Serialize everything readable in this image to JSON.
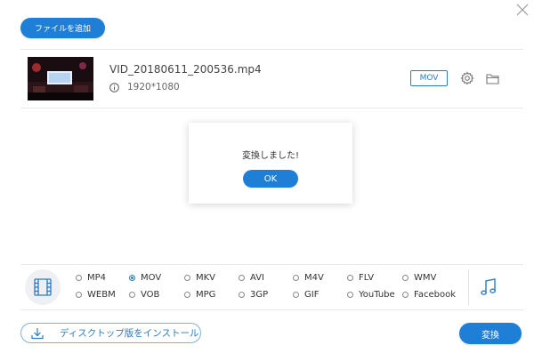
{
  "toolbar": {
    "add_file_label": "ファイルを追加"
  },
  "file": {
    "name": "VID_20180611_200536.mp4",
    "resolution": "1920*1080",
    "format_badge": "MOV"
  },
  "dialog": {
    "message": "変換しました!",
    "ok_label": "OK"
  },
  "formats": {
    "selected": "MOV",
    "row1": [
      "MP4",
      "MOV",
      "MKV",
      "AVI",
      "M4V",
      "FLV",
      "WMV"
    ],
    "row2": [
      "WEBM",
      "VOB",
      "MPG",
      "3GP",
      "GIF",
      "YouTube",
      "Facebook"
    ]
  },
  "footer": {
    "install_label": "ディスクトップ版をインストール",
    "convert_label": "変換"
  },
  "colors": {
    "accent": "#1f7fd6",
    "border_accent": "#2a7bc4"
  },
  "icons": [
    "close-icon",
    "info-icon",
    "gear-icon",
    "folder-icon",
    "film-icon",
    "music-icon",
    "download-icon"
  ]
}
